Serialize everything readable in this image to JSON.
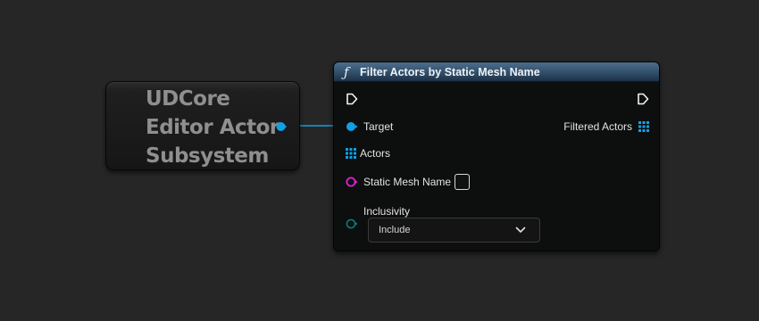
{
  "subsystem_node": {
    "title_lines": [
      "UDCore",
      "Editor Actor",
      "Subsystem"
    ]
  },
  "function_node": {
    "icon": "function-f-icon",
    "title": "Filter Actors by Static Mesh Name",
    "pins": {
      "target": {
        "label": "Target",
        "color": "#0fa1e6"
      },
      "filtered_actors": {
        "label": "Filtered Actors",
        "color": "#0fa1e6"
      },
      "actors": {
        "label": "Actors",
        "color": "#0fa1e6"
      },
      "static_mesh_name": {
        "label": "Static Mesh Name",
        "color": "#e020d8",
        "value": ""
      },
      "inclusivity": {
        "label": "Inclusivity",
        "color": "#087a7a",
        "selected": "Include"
      }
    }
  },
  "colors": {
    "background": "#262626",
    "header": "#3c5a76",
    "object_pin": "#0fa1e6",
    "name_pin": "#e020d8",
    "enum_pin": "#087a7a",
    "exec_pin": "#ffffff"
  }
}
